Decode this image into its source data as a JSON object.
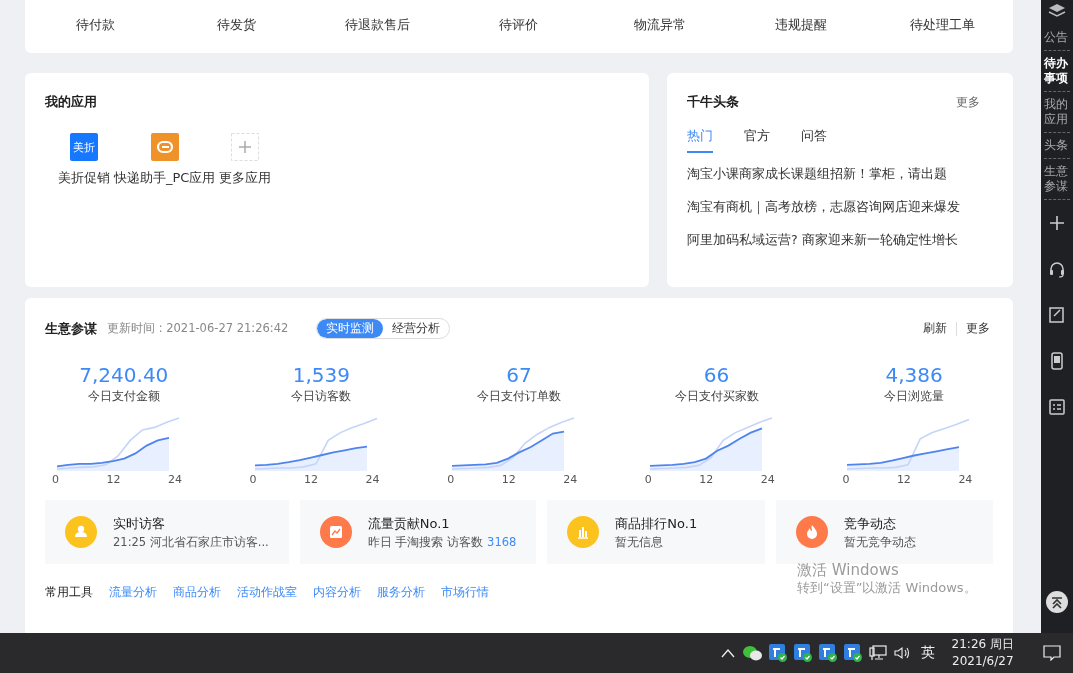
{
  "order_stats": [
    {
      "label": "待付款"
    },
    {
      "label": "待发货"
    },
    {
      "label": "待退款售后"
    },
    {
      "label": "待评价"
    },
    {
      "label": "物流异常"
    },
    {
      "label": "违规提醒"
    },
    {
      "label": "待处理工单"
    }
  ],
  "my_apps": {
    "title": "我的应用",
    "apps": [
      {
        "label": "美折促销",
        "kind": "meizhe",
        "icon_text": "美折"
      },
      {
        "label": "快递助手_PC应用",
        "kind": "express"
      },
      {
        "label": "更多应用",
        "kind": "add"
      }
    ]
  },
  "news": {
    "title": "千牛头条",
    "more": "更多",
    "tabs": [
      {
        "label": "热门",
        "selected": true
      },
      {
        "label": "官方",
        "selected": false
      },
      {
        "label": "问答",
        "selected": false
      }
    ],
    "items": [
      "淘宝小课商家成长课题组招新！掌柜，请出题",
      "淘宝有商机｜高考放榜，志愿咨询网店迎来爆发",
      "阿里加码私域运营? 商家迎来新一轮确定性增长"
    ]
  },
  "business": {
    "title": "生意参谋",
    "updated": "更新时间 : 2021-06-27 21:26:42",
    "tabs": [
      {
        "label": "实时监测",
        "selected": true
      },
      {
        "label": "经营分析",
        "selected": false
      }
    ],
    "refresh": "刷新",
    "more": "更多",
    "metrics": [
      {
        "value": "7,240.40",
        "label": "今日支付金额",
        "ticks": [
          "0",
          "12",
          "24"
        ]
      },
      {
        "value": "1,539",
        "label": "今日访客数",
        "ticks": [
          "0",
          "12",
          "24"
        ]
      },
      {
        "value": "67",
        "label": "今日支付订单数",
        "ticks": [
          "0",
          "12",
          "24"
        ]
      },
      {
        "value": "66",
        "label": "今日支付买家数",
        "ticks": [
          "0",
          "12",
          "24"
        ]
      },
      {
        "value": "4,386",
        "label": "今日浏览量",
        "ticks": [
          "0",
          "12",
          "24"
        ]
      }
    ],
    "info_cards": [
      {
        "kind": "visitor",
        "color": "#fcc31e",
        "title": "实时访客",
        "detail": "21:25 河北省石家庄市访客..."
      },
      {
        "kind": "traffic",
        "color": "#ff7a4b",
        "title": "流量贡献No.1",
        "detail": "昨日 手淘搜索 访客数",
        "highlight": "3168"
      },
      {
        "kind": "ranking",
        "color": "#fcc31e",
        "title": "商品排行No.1",
        "detail": "暂无信息"
      },
      {
        "kind": "competition",
        "color": "#ff7a4b",
        "title": "竞争动态",
        "detail": "暂无竞争动态"
      }
    ],
    "tools": {
      "label": "常用工具",
      "links": [
        "流量分析",
        "商品分析",
        "活动作战室",
        "内容分析",
        "服务分析",
        "市场行情"
      ]
    }
  },
  "side_bar": {
    "items": [
      {
        "label": "公告",
        "selected": false
      },
      {
        "label": "待办事项",
        "selected": true
      },
      {
        "label": "我的应用",
        "selected": false
      },
      {
        "label": "头条",
        "selected": false
      },
      {
        "label": "生意参谋",
        "selected": false
      }
    ]
  },
  "activation_notice": {
    "title": "激活 Windows",
    "hint": "转到“设置”以激活 Windows。"
  },
  "taskbar": {
    "input_method": "英",
    "time": "21:26 周日",
    "date": "2021/6/27"
  }
}
